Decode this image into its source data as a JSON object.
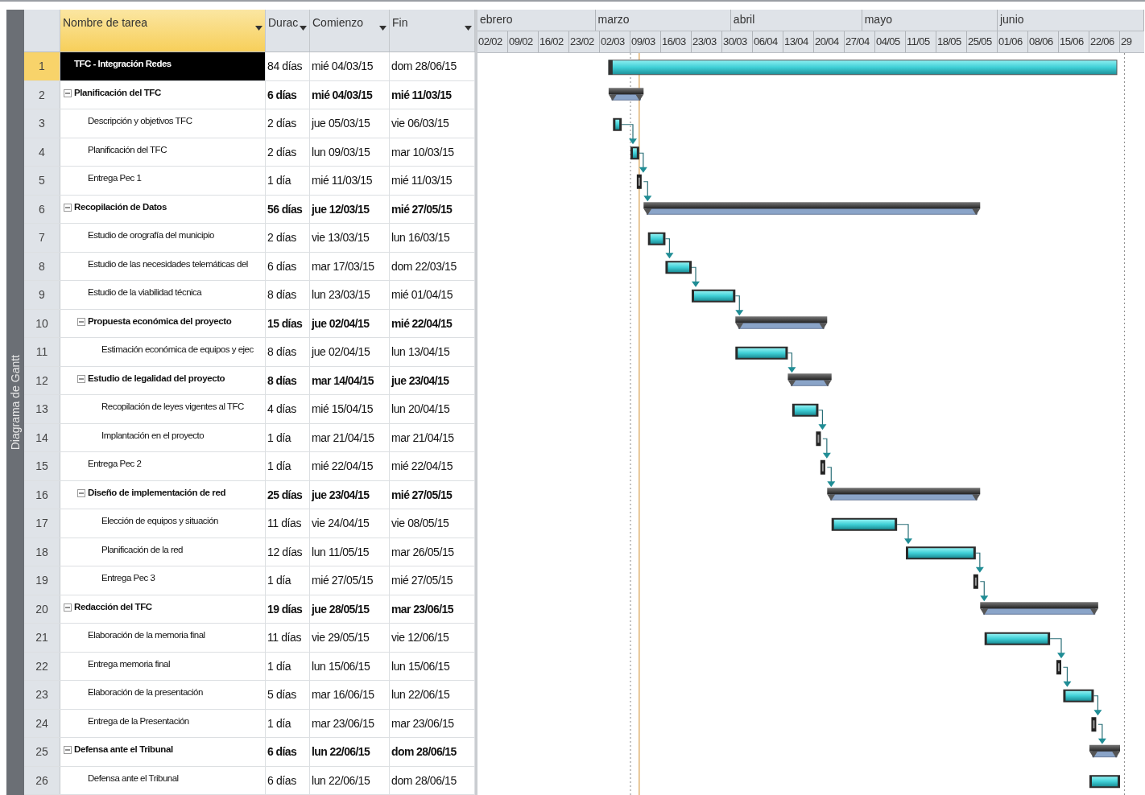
{
  "side_label": "Diagrama de Gantt",
  "columns": [
    {
      "label": "Nombre de tarea",
      "selected": true
    },
    {
      "label": "Durac",
      "selected": false
    },
    {
      "label": "Comienzo",
      "selected": false
    },
    {
      "label": "Fin",
      "selected": false
    }
  ],
  "timescale": {
    "months": [
      "ebrero",
      "marzo",
      "abril",
      "mayo",
      "junio"
    ],
    "weeks": [
      "02/02",
      "09/02",
      "16/02",
      "23/02",
      "02/03",
      "09/03",
      "16/03",
      "23/03",
      "30/03",
      "06/04",
      "13/04",
      "20/04",
      "27/04",
      "04/05",
      "11/05",
      "18/05",
      "25/05",
      "01/06",
      "08/06",
      "15/06",
      "22/06",
      "29"
    ]
  },
  "tasks": [
    {
      "id": "1",
      "name": "TFC - Integración Redes",
      "duration": "84 días",
      "start": "mié 04/03/15",
      "finish": "dom 28/06/15",
      "kind": "project",
      "selected": true,
      "children": [
        {
          "id": "2",
          "name": "Planificación del TFC",
          "duration": "6 días",
          "start": "mié 04/03/15",
          "finish": "mié 11/03/15",
          "kind": "summary",
          "expanded": true,
          "selected": false,
          "children": [
            {
              "id": "3",
              "name": "Descripción y objetivos TFC",
              "duration": "2 días",
              "start": "jue 05/03/15",
              "finish": "vie 06/03/15",
              "kind": "task",
              "selected": false
            },
            {
              "id": "4",
              "name": "Planificación del TFC",
              "duration": "2 días",
              "start": "lun 09/03/15",
              "finish": "mar 10/03/15",
              "kind": "task",
              "selected": false,
              "linked": true
            },
            {
              "id": "5",
              "name": "Entrega Pec 1",
              "duration": "1 día",
              "start": "mié 11/03/15",
              "finish": "mié 11/03/15",
              "kind": "milestone",
              "selected": false,
              "linked": true
            }
          ]
        },
        {
          "id": "6",
          "name": "Recopilación de Datos",
          "duration": "56 días",
          "start": "jue 12/03/15",
          "finish": "mié 27/05/15",
          "kind": "summary",
          "expanded": true,
          "selected": false,
          "linked": true,
          "children": [
            {
              "id": "7",
              "name": "Estudio de orografía del municipio",
              "duration": "2 días",
              "start": "vie 13/03/15",
              "finish": "lun 16/03/15",
              "kind": "task",
              "selected": false
            },
            {
              "id": "8",
              "name": "Estudio de las necesidades telemáticas del",
              "duration": "6 días",
              "start": "mar 17/03/15",
              "finish": "dom 22/03/15",
              "kind": "task",
              "selected": false,
              "linked": true
            },
            {
              "id": "9",
              "name": "Estudio de la viabilidad técnica",
              "duration": "8 días",
              "start": "lun 23/03/15",
              "finish": "mié 01/04/15",
              "kind": "task",
              "selected": false,
              "linked": true
            },
            {
              "id": "10",
              "name": "Propuesta económica del proyecto",
              "duration": "15 días",
              "start": "jue 02/04/15",
              "finish": "mié 22/04/15",
              "kind": "summary",
              "expanded": true,
              "selected": false,
              "linked": true,
              "children": [
                {
                  "id": "11",
                  "name": "Estimación económica de equipos y ejec",
                  "duration": "8 días",
                  "start": "jue 02/04/15",
                  "finish": "lun 13/04/15",
                  "kind": "task",
                  "selected": false
                }
              ]
            },
            {
              "id": "12",
              "name": "Estudio de legalidad del proyecto",
              "duration": "8 días",
              "start": "mar 14/04/15",
              "finish": "jue 23/04/15",
              "kind": "summary",
              "expanded": true,
              "selected": false,
              "linked": true,
              "children": [
                {
                  "id": "13",
                  "name": "Recopilación de leyes vigentes al TFC",
                  "duration": "4 días",
                  "start": "mié 15/04/15",
                  "finish": "lun 20/04/15",
                  "kind": "task",
                  "selected": false
                },
                {
                  "id": "14",
                  "name": "Implantación en el proyecto",
                  "duration": "1 día",
                  "start": "mar 21/04/15",
                  "finish": "mar 21/04/15",
                  "kind": "milestone",
                  "selected": false,
                  "linked": true
                }
              ]
            },
            {
              "id": "15",
              "name": "Entrega Pec 2",
              "duration": "1 día",
              "start": "mié 22/04/15",
              "finish": "mié 22/04/15",
              "kind": "milestone",
              "selected": false,
              "linked": true
            },
            {
              "id": "16",
              "name": "Diseño de implementación de red",
              "duration": "25 días",
              "start": "jue 23/04/15",
              "finish": "mié 27/05/15",
              "kind": "summary",
              "expanded": true,
              "selected": false,
              "linked": true,
              "children": [
                {
                  "id": "17",
                  "name": "Elección de equipos y situación",
                  "duration": "11 días",
                  "start": "vie 24/04/15",
                  "finish": "vie 08/05/15",
                  "kind": "task",
                  "selected": false
                },
                {
                  "id": "18",
                  "name": "Planificación de la red",
                  "duration": "12 días",
                  "start": "lun 11/05/15",
                  "finish": "mar 26/05/15",
                  "kind": "task",
                  "selected": false,
                  "linked": true
                },
                {
                  "id": "19",
                  "name": "Entrega Pec 3",
                  "duration": "1 día",
                  "start": "mié 27/05/15",
                  "finish": "mié 27/05/15",
                  "kind": "milestone",
                  "selected": false,
                  "linked": true
                }
              ]
            }
          ]
        },
        {
          "id": "20",
          "name": "Redacción del TFC",
          "duration": "19 días",
          "start": "jue 28/05/15",
          "finish": "mar 23/06/15",
          "kind": "summary",
          "expanded": true,
          "selected": false,
          "linked": true,
          "children": [
            {
              "id": "21",
              "name": "Elaboración de la memoria final",
              "duration": "11 días",
              "start": "vie 29/05/15",
              "finish": "vie 12/06/15",
              "kind": "task",
              "selected": false
            },
            {
              "id": "22",
              "name": "Entrega memoria final",
              "duration": "1 día",
              "start": "lun 15/06/15",
              "finish": "lun 15/06/15",
              "kind": "milestone",
              "selected": false,
              "linked": true
            },
            {
              "id": "23",
              "name": "Elaboración de la presentación",
              "duration": "5 días",
              "start": "mar 16/06/15",
              "finish": "lun 22/06/15",
              "kind": "task",
              "selected": false,
              "linked": true
            },
            {
              "id": "24",
              "name": "Entrega de la Presentación",
              "duration": "1 día",
              "start": "mar 23/06/15",
              "finish": "mar 23/06/15",
              "kind": "milestone",
              "selected": false,
              "linked": true
            }
          ]
        },
        {
          "id": "25",
          "name": "Defensa ante el Tribunal",
          "duration": "6 días",
          "start": "lun 22/06/15",
          "finish": "dom 28/06/15",
          "kind": "summary",
          "expanded": true,
          "selected": false,
          "linked": true,
          "children": [
            {
              "id": "26",
              "name": "Defensa ante el Tribunal",
              "duration": "6 días",
              "start": "lun 22/06/15",
              "finish": "dom 28/06/15",
              "kind": "task",
              "selected": false
            }
          ]
        }
      ]
    }
  ]
}
